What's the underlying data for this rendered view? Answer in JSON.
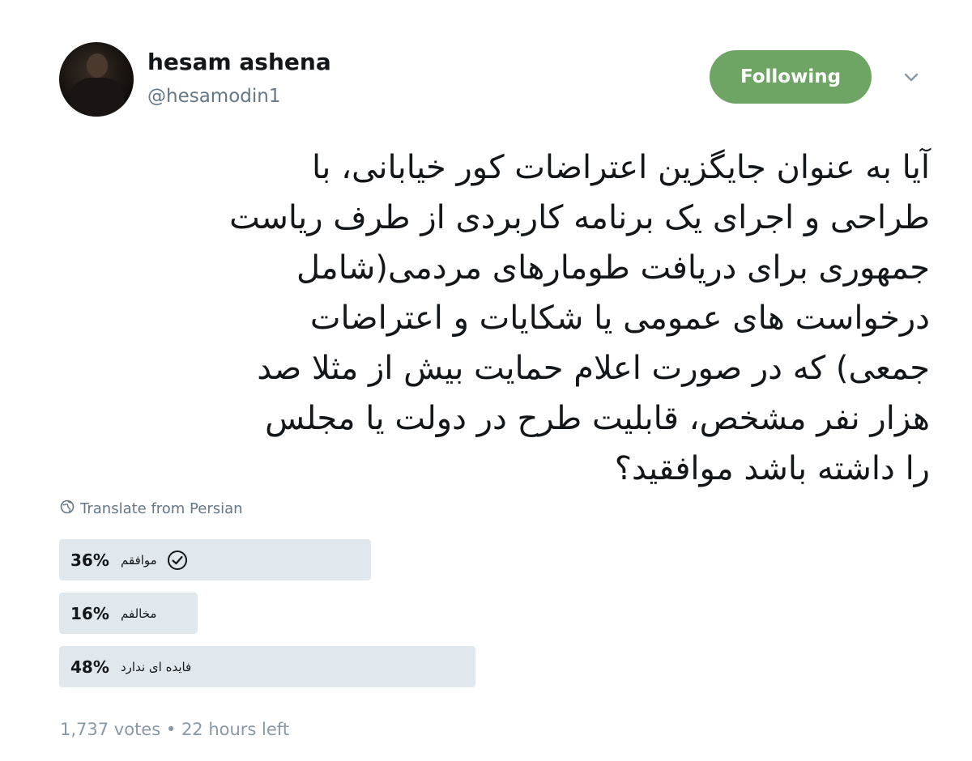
{
  "author": {
    "display_name": "hesam ashena",
    "handle": "@hesamodin1"
  },
  "follow_button_label": "Following",
  "icons": {
    "more_menu": "chevron-down-icon",
    "translate": "globe-icon",
    "voted_check": "check-circle-icon"
  },
  "colors": {
    "following_button": "#6fa564",
    "poll_bar": "#e1e8ed",
    "muted_text": "#657786"
  },
  "tweet_text": "آیا به عنوان جایگزین اعتراضات کور خیابانی، با\nطراحی و اجرای یک برنامه کاربردی از طرف ریاست\nجمهوری برای دریافت طومارهای مردمی(شامل\nدرخواست های عمومی یا شکایات و اعتراضات\nجمعی) که در صورت اعلام حمایت بیش از مثلا صد\nهزار نفر مشخص، قابلیت طرح در دولت یا مجلس\nرا داشته باشد موافقید؟",
  "translate_label": "Translate from Persian",
  "poll": {
    "options": [
      {
        "percent_label": "36%",
        "percent": 36,
        "label": "موافقم",
        "selected": true
      },
      {
        "percent_label": "16%",
        "percent": 16,
        "label": "مخالفم",
        "selected": false
      },
      {
        "percent_label": "48%",
        "percent": 48,
        "label": "فایده ای ندارد",
        "selected": false
      }
    ],
    "votes_label": "1,737 votes",
    "separator": "•",
    "time_left": "22 hours left"
  }
}
